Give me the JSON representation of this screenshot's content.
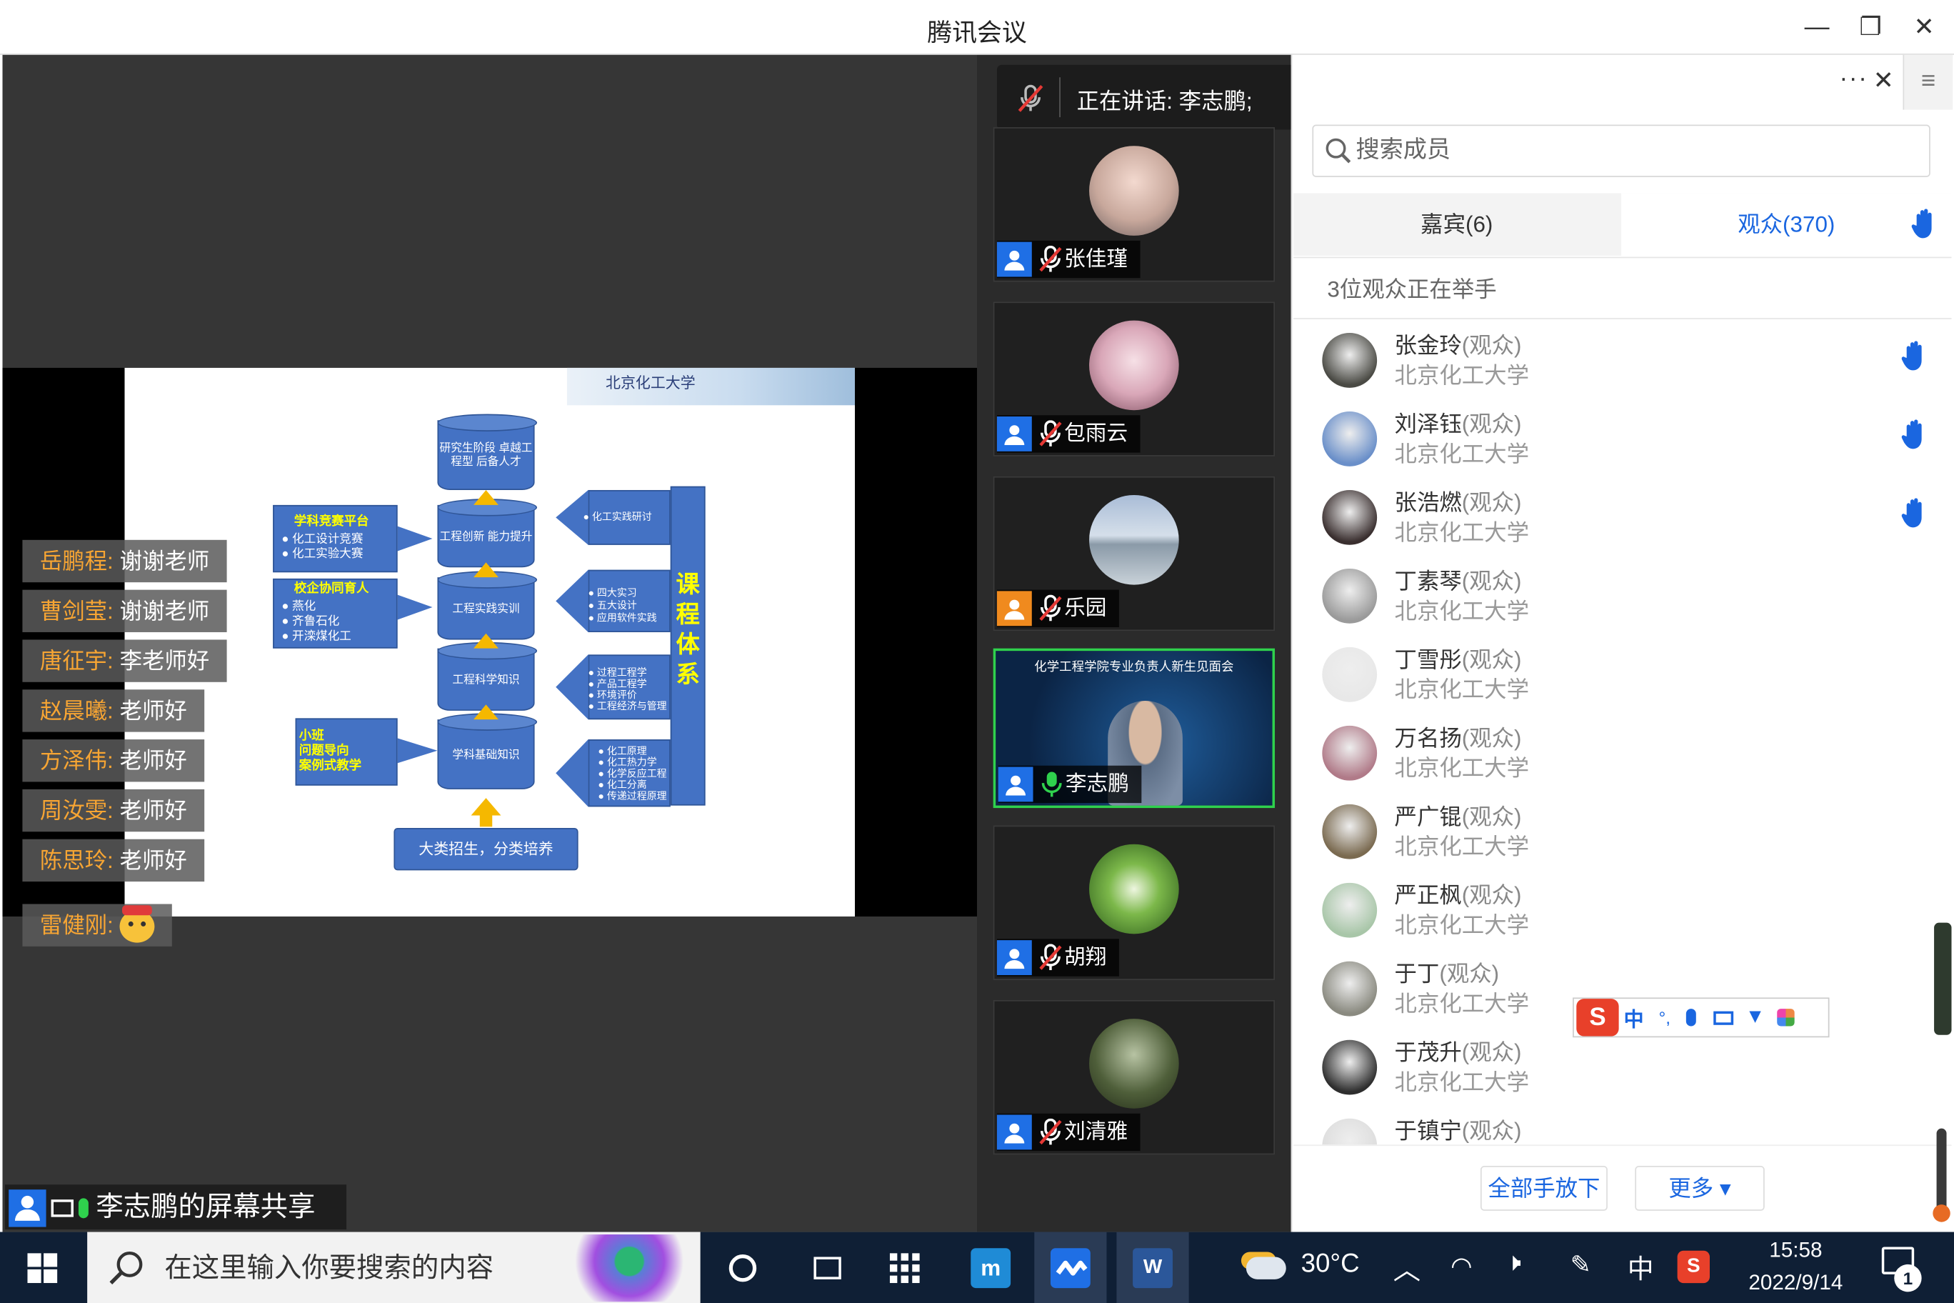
{
  "window": {
    "title": "腾讯会议",
    "min": "—",
    "max": "❐",
    "close": "✕"
  },
  "speaking": {
    "label": "正在讲话: 李志鹏;"
  },
  "chat": [
    {
      "name": "岳鹏程:",
      "text": "谢谢老师"
    },
    {
      "name": "曹剑莹:",
      "text": "谢谢老师"
    },
    {
      "name": "唐征宇:",
      "text": "李老师好"
    },
    {
      "name": "赵晨曦:",
      "text": "老师好"
    },
    {
      "name": "方泽伟:",
      "text": "老师好"
    },
    {
      "name": "周汝雯:",
      "text": "老师好"
    },
    {
      "name": "陈思玲:",
      "text": "老师好"
    },
    {
      "name": "雷健刚:",
      "text": ""
    }
  ],
  "share": {
    "label": "李志鹏的屏幕共享"
  },
  "slide": {
    "header": "北京化工大学",
    "cyl1": "研究生阶段 卓越工程型 后备人才",
    "cyl2": "工程创新 能力提升",
    "cyl3": "工程实践实训",
    "cyl4": "工程科学知识",
    "cyl5": "学科基础知识",
    "left1_title": "学科竞赛平台",
    "left1_items": [
      "化工设计竞赛",
      "化工实验大赛"
    ],
    "left2_title": "校企协同育人",
    "left2_items": [
      "燕化",
      "齐鲁石化",
      "开滦煤化工"
    ],
    "left3": [
      "小班",
      "问题导向",
      "案例式教学"
    ],
    "bottom": "大类招生，分类培养",
    "right_title": "课程体系",
    "right1": [
      "化工实践研讨"
    ],
    "right2": [
      "四大实习",
      "五大设计",
      "应用软件实践"
    ],
    "right3": [
      "过程工程学",
      "产品工程学",
      "环境评价",
      "工程经济与管理"
    ],
    "right4": [
      "化工原理",
      "化工热力学",
      "化学反应工程",
      "化工分离",
      "传递过程原理"
    ]
  },
  "tiles": [
    {
      "name": "张佳瑾"
    },
    {
      "name": "包雨云"
    },
    {
      "name": "乐园"
    },
    {
      "name": "李志鹏",
      "banner": "化学工程学院专业负责人新生见面会"
    },
    {
      "name": "胡翔"
    },
    {
      "name": "刘清雅"
    }
  ],
  "panel": {
    "search_placeholder": "搜索成员",
    "tab_guests": "嘉宾(6)",
    "tab_audience": "观众(370)",
    "raise_info": "3位观众正在举手",
    "btn_lower_all": "全部手放下",
    "btn_more": "更多 ▾"
  },
  "members": [
    {
      "name": "张金玲",
      "role": "(观众)",
      "org": "北京化工大学",
      "hand": true,
      "color": "#4a4a44"
    },
    {
      "name": "刘泽钰",
      "role": "(观众)",
      "org": "北京化工大学",
      "hand": true,
      "color": "#6a8fc9"
    },
    {
      "name": "张浩燃",
      "role": "(观众)",
      "org": "北京化工大学",
      "hand": true,
      "color": "#3a2f2f"
    },
    {
      "name": "丁素琴",
      "role": "(观众)",
      "org": "北京化工大学",
      "hand": false,
      "color": "#9a9a9a"
    },
    {
      "name": "丁雪彤",
      "role": "(观众)",
      "org": "北京化工大学",
      "hand": false,
      "color": "#e8e8e8"
    },
    {
      "name": "万名扬",
      "role": "(观众)",
      "org": "北京化工大学",
      "hand": false,
      "color": "#b07a88"
    },
    {
      "name": "严广锟",
      "role": "(观众)",
      "org": "北京化工大学",
      "hand": false,
      "color": "#7a6a50"
    },
    {
      "name": "严正枫",
      "role": "(观众)",
      "org": "北京化工大学",
      "hand": false,
      "color": "#a8c6a8"
    },
    {
      "name": "于丁",
      "role": "(观众)",
      "org": "北京化工大学",
      "hand": false,
      "color": "#8a8a80"
    },
    {
      "name": "于茂升",
      "role": "(观众)",
      "org": "北京化工大学",
      "hand": false,
      "color": "#2e2e2e"
    },
    {
      "name": "于镇宁",
      "role": "(观众)",
      "org": "",
      "hand": false,
      "color": "#dddddd"
    }
  ],
  "ime": {
    "label": "中"
  },
  "taskbar": {
    "search": "在这里输入你要搜索的内容",
    "weather": "30°C",
    "lang": "中",
    "time": "15:58",
    "date": "2022/9/14",
    "notif": "1"
  }
}
